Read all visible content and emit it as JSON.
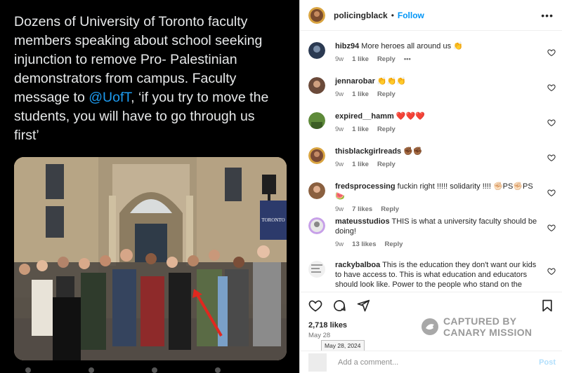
{
  "post": {
    "text_before": "Dozens of University of Toronto faculty members speaking about school seeking injunction to remove Pro- Palestinian demonstrators from campus. Faculty message to ",
    "mention": "@UofT",
    "text_after": ", ‘if you try to move the students, you will have to go through us first’",
    "banner_text": "TORONTO"
  },
  "header": {
    "username": "policingblack",
    "separator": "•",
    "follow_label": "Follow",
    "more_label": "•••"
  },
  "comments": [
    {
      "username": "hibz94",
      "text": "More heroes all around us 👏",
      "age": "9w",
      "likes": "1 like",
      "reply": "Reply",
      "more": "•••",
      "avatar_color": "#2b3a52"
    },
    {
      "username": "jennarobar",
      "text": "👏👏👏",
      "age": "9w",
      "likes": "1 like",
      "reply": "Reply",
      "avatar_color": "#6b4a3a"
    },
    {
      "username": "expired__hamm",
      "text": "❤️❤️❤️",
      "age": "9w",
      "likes": "1 like",
      "reply": "Reply",
      "avatar_color": "#5e8a3a"
    },
    {
      "username": "thisblackgirlreads",
      "text": "✊🏾✊🏾",
      "age": "9w",
      "likes": "1 like",
      "reply": "Reply",
      "avatar_color": "#7a4a36"
    },
    {
      "username": "fredsprocessing",
      "text": "fuckin right !!!!! solidarity !!!! ✊🏻PS✊🏻PS🍉",
      "age": "9w",
      "likes": "7 likes",
      "reply": "Reply",
      "avatar_color": "#8a6040"
    },
    {
      "username": "mateusstudios",
      "text": "THIS is what a university faculty should be doing!",
      "age": "9w",
      "likes": "13 likes",
      "reply": "Reply",
      "avatar_color": "#d8d8d8"
    },
    {
      "username": "rackybalboa",
      "text": "This is the education they don't want our kids to have access to. This is what education and educators should look like. Power to the people who stand on the right side of",
      "age": "",
      "likes": "",
      "reply": "",
      "avatar_color": "#e6e6e6"
    }
  ],
  "actions": {
    "like_icon": "heart-icon",
    "comment_icon": "comment-icon",
    "share_icon": "share-icon",
    "save_icon": "bookmark-icon"
  },
  "likes_count": "2,718 likes",
  "date": "May 28",
  "date_tooltip": "May 28, 2024",
  "watermark": {
    "line1": "CAPTURED BY",
    "line2": "CANARY MISSION"
  },
  "add_comment": {
    "placeholder": "Add a comment...",
    "post_label": "Post"
  },
  "colors": {
    "accent": "#0095f6",
    "mention": "#1d9bf0",
    "left_bg": "#000000"
  }
}
